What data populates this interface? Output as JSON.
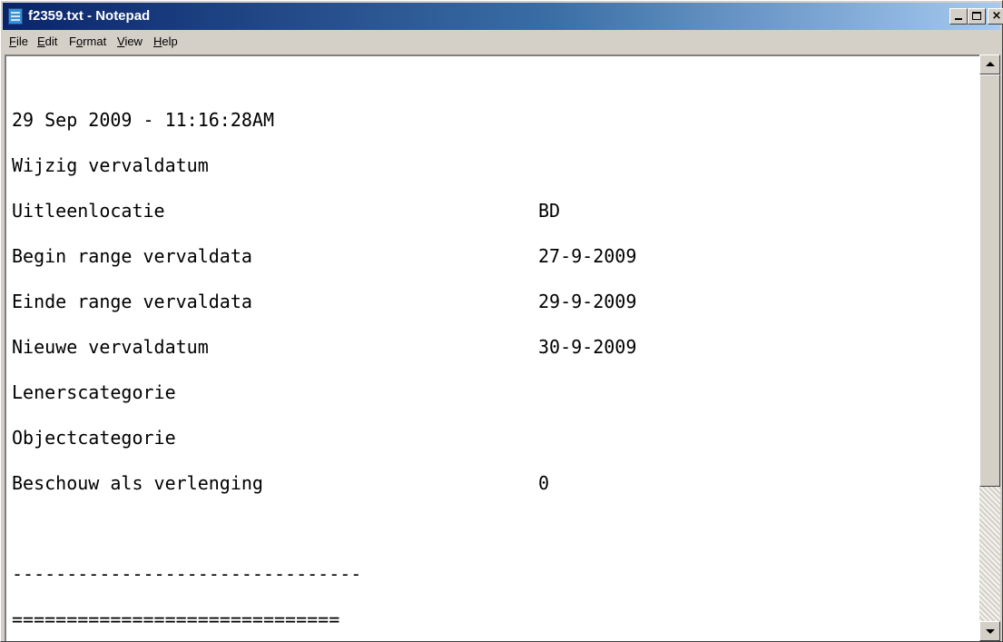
{
  "window": {
    "title": "f2359.txt - Notepad",
    "icon": "notepad-icon",
    "controls": {
      "minimize": "minimize-icon",
      "maximize": "maximize-icon",
      "close": "×"
    }
  },
  "menu": {
    "file": {
      "hotkey": "F",
      "rest": "ile"
    },
    "edit": {
      "hotkey": "E",
      "rest": "dit"
    },
    "format_pre": "F",
    "format_hotkey": "o",
    "format_post": "rmat",
    "view": {
      "hotkey": "V",
      "rest": "iew"
    },
    "help": {
      "hotkey": "H",
      "rest": "elp"
    }
  },
  "document": {
    "lines": [
      {
        "label": "29 Sep 2009 - 11:16:28AM",
        "value": ""
      },
      {
        "label": "Wijzig vervaldatum",
        "value": ""
      },
      {
        "label": "Uitleenlocatie",
        "value": "BD"
      },
      {
        "label": "Begin range vervaldata",
        "value": "27-9-2009"
      },
      {
        "label": "Einde range vervaldata",
        "value": "29-9-2009"
      },
      {
        "label": "Nieuwe vervaldatum",
        "value": "30-9-2009"
      },
      {
        "label": "Lenerscategorie",
        "value": ""
      },
      {
        "label": "Objectcategorie",
        "value": ""
      },
      {
        "label": "Beschouw als verlenging",
        "value": "0"
      },
      {
        "label": "",
        "value": ""
      },
      {
        "label": "--------------------------------",
        "value": ""
      },
      {
        "label": "==============================",
        "value": ""
      }
    ]
  },
  "colors": {
    "titlebar_start": "#0a246a",
    "titlebar_end": "#a6caf0",
    "chrome": "#d4d0c8",
    "editor_bg": "#ffffff"
  }
}
